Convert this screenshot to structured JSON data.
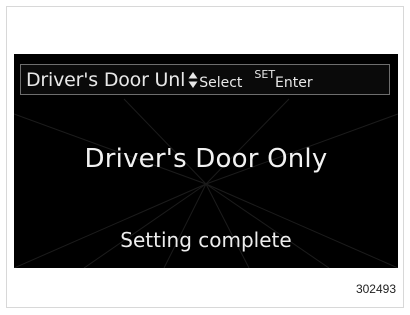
{
  "display": {
    "header_title": "Driver's Door Unl",
    "select_icon": "up-down-arrows-icon",
    "select_label": "Select",
    "set_label": "SET",
    "enter_label": "Enter",
    "value": "Driver's Door Only",
    "status": "Setting complete"
  },
  "figure_id": "302493",
  "colors": {
    "screen_bg": "#000000",
    "text": "#f2f2f2",
    "header_border": "#6e6e6e"
  }
}
